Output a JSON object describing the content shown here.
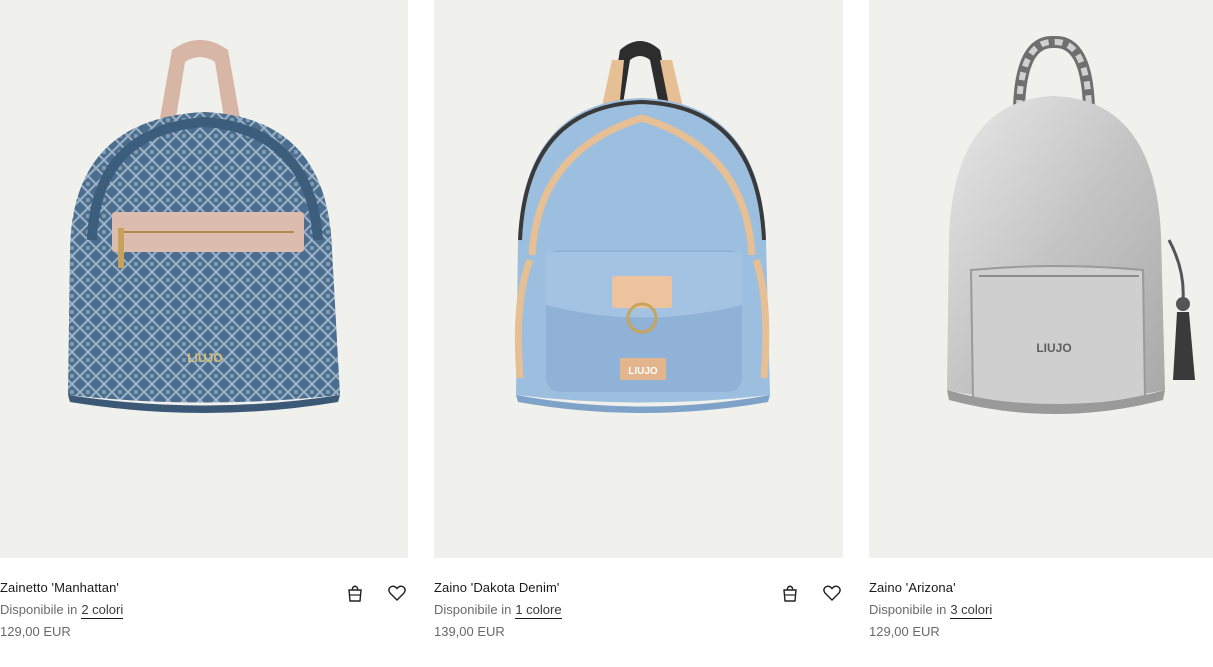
{
  "products": [
    {
      "name": "Zainetto 'Manhattan'",
      "availability_prefix": "Disponibile in",
      "colors_link": "2 colori",
      "price": "129,00 EUR",
      "image_desc": "blue-monogram-backpack",
      "logo": "LIUJO"
    },
    {
      "name": "Zaino 'Dakota Denim'",
      "availability_prefix": "Disponibile in",
      "colors_link": "1 colore",
      "price": "139,00 EUR",
      "image_desc": "light-denim-backpack",
      "logo": "LIUJO"
    },
    {
      "name": "Zaino 'Arizona'",
      "availability_prefix": "Disponibile in",
      "colors_link": "3 colori",
      "price": "129,00 EUR",
      "image_desc": "silver-metallic-backpack",
      "logo": "LIUJO"
    }
  ],
  "icons": {
    "bag": "shopping-bag-icon",
    "wishlist": "heart-icon"
  },
  "colors": {
    "image_bg": "#f0f0ed",
    "text": "#1a1a1a",
    "muted": "#6a6a6a"
  }
}
